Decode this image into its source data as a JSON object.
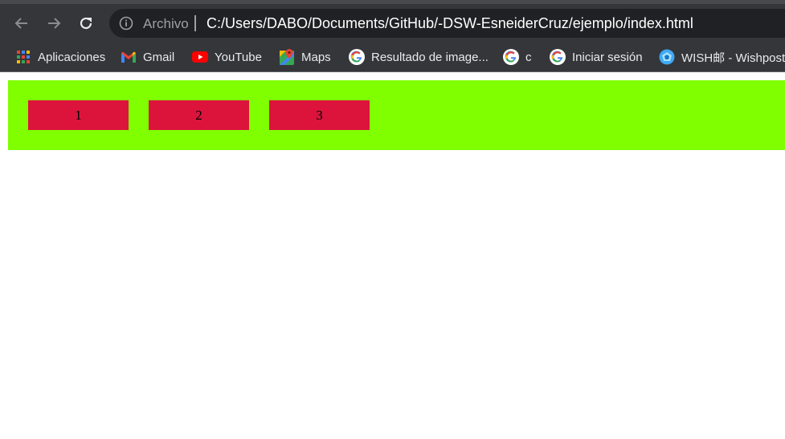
{
  "browser": {
    "address_bar": {
      "security_label": "Archivo",
      "url": "C:/Users/DABO/Documents/GitHub/-DSW-EsneiderCruz/ejemplo/index.html"
    },
    "bookmarks": [
      {
        "label": "Aplicaciones",
        "icon": "apps-grid-icon"
      },
      {
        "label": "Gmail",
        "icon": "gmail-icon"
      },
      {
        "label": "YouTube",
        "icon": "youtube-icon"
      },
      {
        "label": "Maps",
        "icon": "maps-icon"
      },
      {
        "label": "Resultado de image...",
        "icon": "google-icon"
      },
      {
        "label": "c",
        "icon": "google-icon"
      },
      {
        "label": "Iniciar sesión",
        "icon": "google-icon"
      },
      {
        "label": "WISH邮 - Wishpost",
        "icon": "wishpost-icon"
      }
    ]
  },
  "page": {
    "background": "#ffffff",
    "bar_color": "#7fff00",
    "box_color": "#dc143c",
    "boxes": [
      "1",
      "2",
      "3"
    ]
  }
}
